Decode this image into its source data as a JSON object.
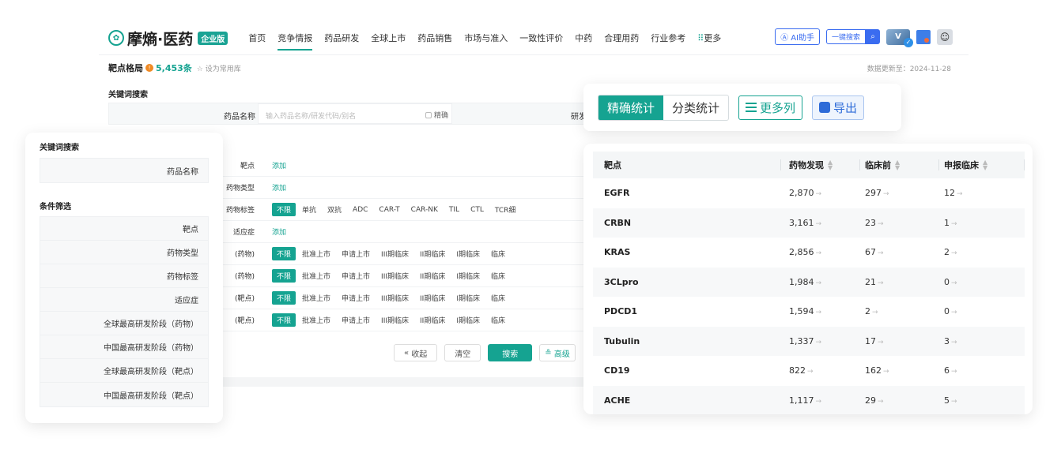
{
  "brand": {
    "name": "摩熵·医药",
    "badge": "企业版",
    "accent": "#15a391"
  },
  "nav": {
    "items": [
      "首页",
      "竞争情报",
      "药品研发",
      "全球上市",
      "药品销售",
      "市场与准入",
      "一致性评价",
      "中药",
      "合理用药",
      "行业参考"
    ],
    "more": "更多",
    "ai": "AI助手",
    "quick_search": "一键搜索"
  },
  "subheader": {
    "title": "靶点格局",
    "count": "5,453条",
    "fav": "设为常用库",
    "updated": "数据更新至：2024-11-28"
  },
  "keyword": {
    "title": "关键词搜索",
    "label": "药品名称",
    "placeholder": "输入药品名称/研发代码/别名",
    "exact": "精确",
    "right_label": "研发"
  },
  "filters": {
    "rows": [
      {
        "label": "靶点",
        "type": "add",
        "text": "添加"
      },
      {
        "label": "药物类型",
        "type": "add",
        "text": "添加"
      },
      {
        "label": "药物标签",
        "type": "opts",
        "opts": [
          "单抗",
          "双抗",
          "ADC",
          "CAR-T",
          "CAR-NK",
          "TIL",
          "CTL",
          "TCR细"
        ]
      },
      {
        "label": "适应症",
        "type": "add",
        "text": "添加"
      },
      {
        "label": "(药物)",
        "type": "opts",
        "opts": [
          "批准上市",
          "申请上市",
          "III期临床",
          "II期临床",
          "I期临床",
          "临床"
        ]
      },
      {
        "label": "(药物)",
        "type": "opts",
        "opts": [
          "批准上市",
          "申请上市",
          "III期临床",
          "II期临床",
          "I期临床",
          "临床"
        ]
      },
      {
        "label": "(靶点)",
        "type": "opts",
        "opts": [
          "批准上市",
          "申请上市",
          "III期临床",
          "II期临床",
          "I期临床",
          "临床"
        ]
      },
      {
        "label": "(靶点)",
        "type": "opts",
        "opts": [
          "批准上市",
          "申请上市",
          "III期临床",
          "II期临床",
          "I期临床",
          "临床"
        ]
      }
    ],
    "unlimited": "不限"
  },
  "actions": {
    "collapse": "收起",
    "clear": "清空",
    "search": "搜索",
    "advanced": "高级"
  },
  "left_card": {
    "kw_title": "关键词搜索",
    "kw_label": "药品名称",
    "cond_title": "条件筛选",
    "conds": [
      "靶点",
      "药物类型",
      "药物标签",
      "适应症",
      "全球最高研发阶段（药物）",
      "中国最高研发阶段（药物）",
      "全球最高研发阶段（靶点）",
      "中国最高研发阶段（靶点）"
    ]
  },
  "toolbar": {
    "seg": [
      "精确统计",
      "分类统计"
    ],
    "more_cols": "更多列",
    "export": "导出"
  },
  "table": {
    "headers": [
      "靶点",
      "药物发现",
      "临床前",
      "申报临床"
    ],
    "rows": [
      [
        "EGFR",
        "2,870",
        "297",
        "12"
      ],
      [
        "CRBN",
        "3,161",
        "23",
        "1"
      ],
      [
        "KRAS",
        "2,856",
        "67",
        "2"
      ],
      [
        "3CLpro",
        "1,984",
        "21",
        "0"
      ],
      [
        "PDCD1",
        "1,594",
        "2",
        "0"
      ],
      [
        "Tubulin",
        "1,337",
        "17",
        "3"
      ],
      [
        "CD19",
        "822",
        "162",
        "6"
      ],
      [
        "ACHE",
        "1,117",
        "29",
        "5"
      ]
    ]
  }
}
